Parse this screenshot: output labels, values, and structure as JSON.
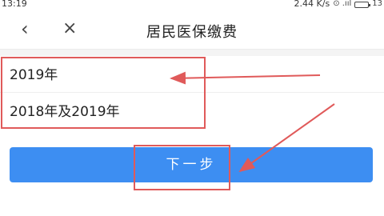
{
  "status_bar": {
    "time": "13:19",
    "speed": "2.44 K/s",
    "signal": "⊙ .ııl",
    "battery": "13"
  },
  "nav": {
    "back_icon": "chevron-left-icon",
    "close_icon": "close-icon",
    "title": "居民医保缴费"
  },
  "options": [
    {
      "label": "2019年"
    },
    {
      "label": "2018年及2019年"
    }
  ],
  "next_button": {
    "label": "下一步"
  },
  "colors": {
    "accent": "#3d8ef2",
    "annotation": "#e05a5a"
  }
}
